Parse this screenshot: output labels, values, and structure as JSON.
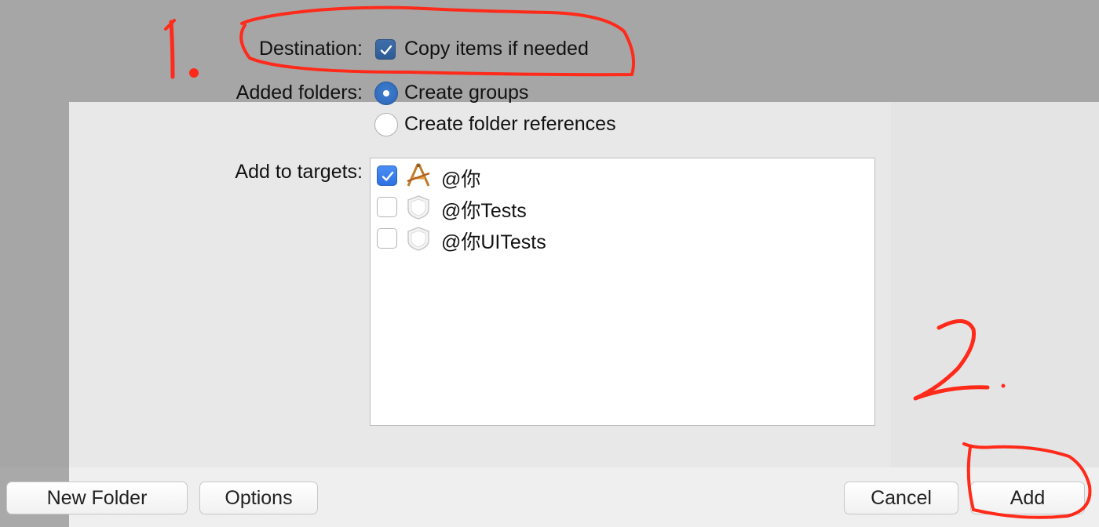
{
  "dialog": {
    "destination": {
      "label": "Destination:",
      "option_label": "Copy items if needed",
      "checked": true
    },
    "added_folders": {
      "label": "Added folders:",
      "options": [
        {
          "label": "Create groups",
          "selected": true
        },
        {
          "label": "Create folder references",
          "selected": false
        }
      ]
    },
    "add_to_targets": {
      "label": "Add to targets:",
      "targets": [
        {
          "name": "@你",
          "checked": true,
          "icon": "app-target-icon"
        },
        {
          "name": "@你Tests",
          "checked": false,
          "icon": "test-bundle-icon"
        },
        {
          "name": "@你UITests",
          "checked": false,
          "icon": "test-bundle-icon"
        }
      ]
    }
  },
  "footer": {
    "new_folder": "New Folder",
    "options": "Options",
    "cancel": "Cancel",
    "add": "Add"
  },
  "annotations": {
    "mark_1": "1.",
    "mark_2": "2.",
    "color": "#ff2a1a"
  }
}
